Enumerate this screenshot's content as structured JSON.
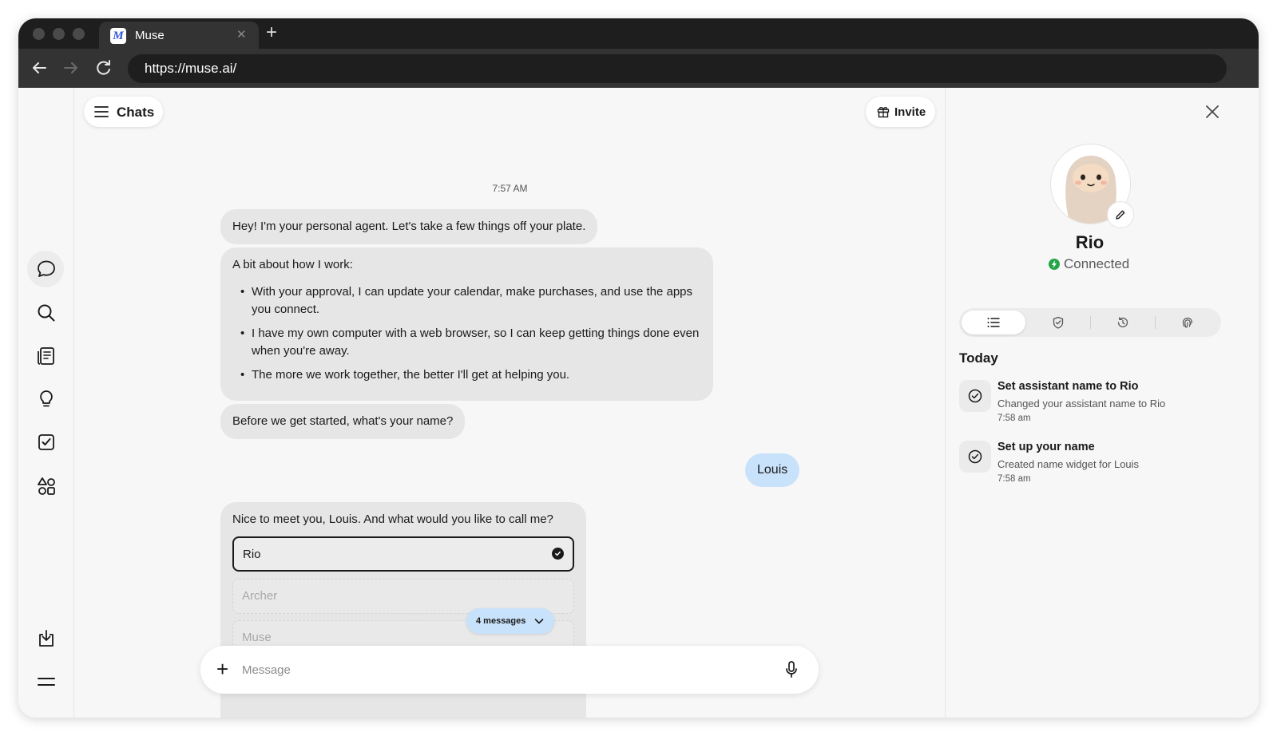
{
  "browser": {
    "tab_title": "Muse",
    "tab_logo": "M",
    "url": "https://muse.ai/"
  },
  "icons": {
    "traffic_lights": [
      "traffic-light-icon",
      "traffic-light-icon",
      "traffic-light-icon"
    ],
    "nav": [
      "back-arrow-icon",
      "forward-arrow-icon",
      "reload-icon"
    ],
    "left_rail": [
      "chat-icon",
      "search-icon",
      "library-icon",
      "lightbulb-icon",
      "checkbox-icon",
      "apps-icon",
      "download-icon",
      "menu-icon"
    ]
  },
  "header": {
    "chats_label": "Chats",
    "invite_label": "Invite"
  },
  "conversation": {
    "timestamp": "7:57 AM",
    "greeting": "Hey! I'm your personal agent. Let's take a few things off your plate.",
    "how_i_work_title": "A bit about how I work:",
    "how_i_work_points": [
      "With your approval, I can update your calendar, make purchases, and use the apps you connect.",
      "I have my own computer with a web browser, so I can keep getting things done even when you're away.",
      "The more we work together, the better I'll get at helping you."
    ],
    "name_question": "Before we get started, what's your name?",
    "user_reply": "Louis",
    "call_me_question": "Nice to meet you, Louis. And what would you like to call me?",
    "name_options": [
      {
        "label": "Rio",
        "selected": true
      },
      {
        "label": "Archer",
        "selected": false
      },
      {
        "label": "Muse",
        "selected": false
      }
    ],
    "new_messages_pill": "4 messages"
  },
  "composer": {
    "placeholder": "Message",
    "value": ""
  },
  "agent_panel": {
    "name": "Rio",
    "status": "Connected",
    "status_color": "#22a447",
    "tabs": [
      "list-icon",
      "shield-check-icon",
      "history-icon",
      "fingerprint-icon"
    ],
    "active_tab": 0,
    "section_title": "Today",
    "activities": [
      {
        "title": "Set assistant name to Rio",
        "description": "Changed your assistant name to Rio",
        "time": "7:58 am"
      },
      {
        "title": "Set up your name",
        "description": "Created name widget for Louis",
        "time": "7:58 am"
      }
    ]
  },
  "colors": {
    "user_bubble": "#c9e2fb",
    "agent_bubble": "#e6e6e6",
    "accent": "#2f52d8"
  }
}
